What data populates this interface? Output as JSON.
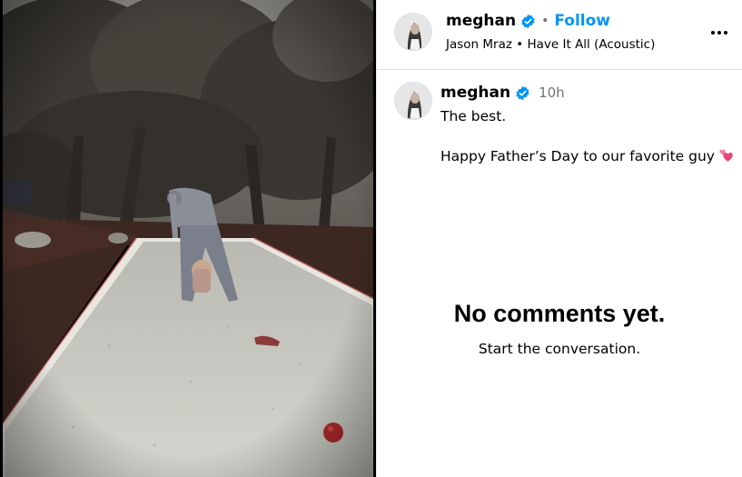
{
  "post": {
    "media": {
      "alt": "Person bending over a child on a gravel bocce court under trees",
      "colors": {
        "trees": "#3f3b36",
        "gravel": "#c9c9c2",
        "soil": "#3a2620",
        "ball": "#b52a2a"
      }
    },
    "header": {
      "username": "meghan",
      "verified_icon": "verified-badge-icon",
      "separator": "•",
      "follow_label": "Follow",
      "audio": "Jason Mraz • Have It All (Acoustic)",
      "more_icon": "more-options-icon"
    },
    "caption": {
      "username": "meghan",
      "time": "10h",
      "line1": "The best.",
      "line2": "Happy Father’s Day to our favorite guy",
      "emoji_icon": "two-hearts-icon"
    },
    "comments": {
      "empty_title": "No comments yet.",
      "empty_subtitle": "Start the conversation."
    },
    "colors": {
      "accent": "#0095f6",
      "verified": "#0095f6",
      "secondary_text": "#737373",
      "divider": "#dbdbdb"
    }
  }
}
